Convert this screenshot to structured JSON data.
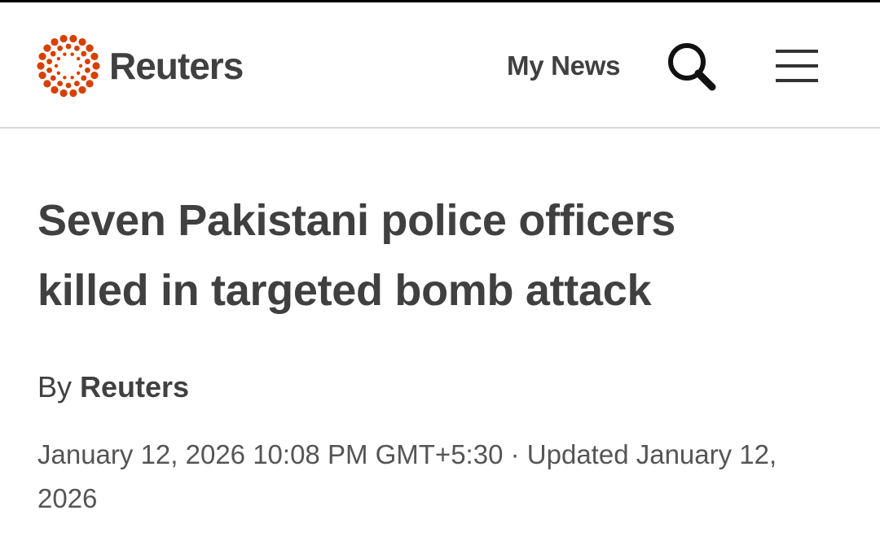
{
  "header": {
    "logo": {
      "brand": "Reuters",
      "mark_icon": "reuters-dot-logo-icon",
      "mark_color": "#d64000"
    },
    "my_news_label": "My News",
    "search_icon": "search-icon",
    "menu_icon": "hamburger-menu-icon"
  },
  "article": {
    "headline_line1": "Seven Pakistani police officers",
    "headline_line2": "killed in targeted bomb attack",
    "byline_prefix": "By",
    "byline_author": "Reuters",
    "published": "January 12, 2026 10:08 PM GMT+5:30",
    "separator": "·",
    "updated_line1": "Updated January 12,",
    "updated_line2": "2026"
  },
  "colors": {
    "text": "#404040",
    "accent": "#d64000",
    "divider": "#d9d9d9"
  }
}
